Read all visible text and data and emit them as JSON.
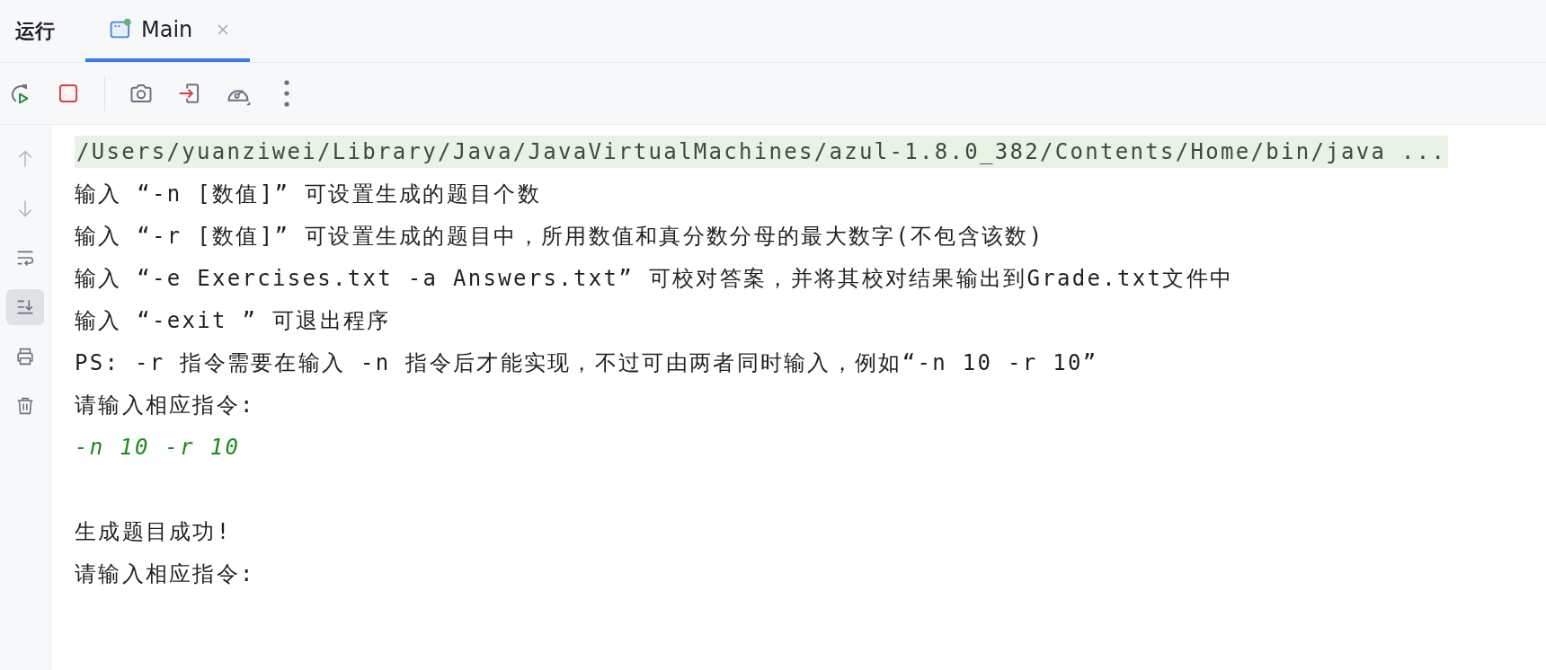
{
  "tool_window": {
    "title": "运行"
  },
  "tabs": [
    {
      "label": "Main",
      "selected": true,
      "running": true,
      "closable": true
    }
  ],
  "toolbar": [
    {
      "kind": "rerun"
    },
    {
      "kind": "stop"
    },
    {
      "kind": "separator"
    },
    {
      "kind": "screenshot"
    },
    {
      "kind": "exit"
    },
    {
      "kind": "profiler"
    },
    {
      "kind": "more"
    }
  ],
  "sidebar": [
    {
      "kind": "up",
      "disabled": true,
      "selected": false
    },
    {
      "kind": "down",
      "disabled": true,
      "selected": false
    },
    {
      "kind": "wrap",
      "disabled": false,
      "selected": false
    },
    {
      "kind": "scroll-end",
      "disabled": false,
      "selected": true
    },
    {
      "kind": "print",
      "disabled": false,
      "selected": false
    },
    {
      "kind": "trash",
      "disabled": false,
      "selected": false
    }
  ],
  "console": [
    {
      "kind": "command",
      "text": "/Users/yuanziwei/Library/Java/JavaVirtualMachines/azul-1.8.0_382/Contents/Home/bin/java ..."
    },
    {
      "kind": "output",
      "text": "输入 “-n [数值]” 可设置生成的题目个数"
    },
    {
      "kind": "output",
      "text": "输入 “-r [数值]” 可设置生成的题目中，所用数值和真分数分母的最大数字(不包含该数)"
    },
    {
      "kind": "output",
      "text": "输入 “-e Exercises.txt -a Answers.txt” 可校对答案，并将其校对结果输出到Grade.txt文件中"
    },
    {
      "kind": "output",
      "text": "输入 “-exit ” 可退出程序"
    },
    {
      "kind": "output",
      "text": "PS: -r 指令需要在输入 -n 指令后才能实现，不过可由两者同时输入，例如“-n 10 -r 10”"
    },
    {
      "kind": "output",
      "text": "请输入相应指令:"
    },
    {
      "kind": "input",
      "text": "-n 10 -r 10"
    },
    {
      "kind": "blank"
    },
    {
      "kind": "output",
      "text": "生成题目成功!"
    },
    {
      "kind": "output",
      "text": "请输入相应指令:"
    }
  ]
}
